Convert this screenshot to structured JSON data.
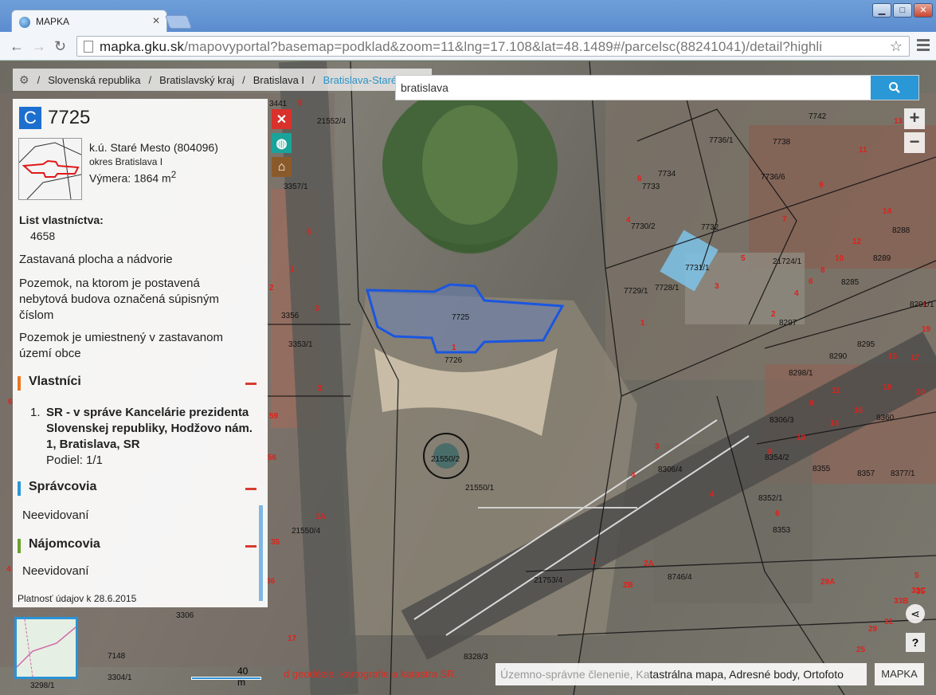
{
  "browser": {
    "tab_title": "MAPKA",
    "url_host": "mapka.gku.sk",
    "url_path": "/mapovyportal?basemap=podklad&zoom=11&lng=17.108&lat=48.1489#/parcelsc(88241041)/detail?highli",
    "win_min": "▁",
    "win_max": "□",
    "win_close": "✕"
  },
  "breadcrumb": {
    "items": [
      "Slovenská republika",
      "Bratislavský kraj",
      "Bratislava I",
      "Bratislava-Staré Mesto"
    ],
    "separator": "/"
  },
  "search": {
    "value": "bratislava"
  },
  "zoom": {
    "in": "+",
    "out": "−"
  },
  "panel": {
    "badge": "C",
    "parcel_number": "7725",
    "ku": "k.ú. Staré Mesto (804096)",
    "okres": "okres Bratislava I",
    "vymera_label": "Výmera: 1864 m",
    "vymera_sup": "2",
    "lv_label": "List vlastníctva:",
    "lv_value": "4658",
    "druh": "Zastavaná plocha a nádvorie",
    "pozemok1": "Pozemok, na ktorom je postavená nebytová budova označená súpisným číslom",
    "pozemok2": "Pozemok je umiestnený v zastavanom území obce",
    "vlastnici_title": "Vlastníci",
    "owner_index": "1.",
    "owner_name": "SR - v správe Kancelárie prezidenta Slovenskej republiky, Hodžovo nám. 1, Bratislava, SR",
    "owner_share": "Podiel: 1/1",
    "spravcovia_title": "Správcovia",
    "spravcovia_value": "Neevidovaní",
    "najomcovia_title": "Nájomcovia",
    "najomcovia_value": "Neevidovaní",
    "platnost": "Platnosť údajov k 28.6.2015"
  },
  "colors": {
    "accent": "#2a97d6",
    "vlastnici": "#e87722",
    "spravcovia": "#2a97d6",
    "najomcovia": "#6aa22c",
    "close": "#d9312b",
    "globe": "#1aa39a",
    "home": "#8b5a2b",
    "parcel_highlight": "#1a56e0"
  },
  "scale": {
    "label": "40 m"
  },
  "footer": {
    "attribution": "d geodézie, kartografie a katastra SR.",
    "layers_muted": "Územno-správne členenie, Ka",
    "layers_active": "tastrálna mapa, Adresné body, Ortofoto",
    "mapa_button": "MAPKA"
  },
  "map_labels": {
    "l1": "7725",
    "l2": "7726",
    "l3": "21550/2",
    "l4": "21550/1",
    "l5": "7732",
    "l6": "7734",
    "l7": "7736/1",
    "l8": "7738",
    "l9": "7742",
    "l10": "7731/1",
    "l11": "21724/1",
    "l12": "8289",
    "l13": "8297",
    "l14": "8306/3",
    "l15": "8306/4",
    "l16": "8357",
    "l17": "8353",
    "l18": "8746/4",
    "l19": "21753/4",
    "l20": "3356",
    "l21": "3441",
    "l22": "21552/4",
    "l23": "3357/1",
    "l24": "3353/1",
    "l25": "21550/4",
    "l26": "3306",
    "l27": "7148",
    "l28": "3298/1",
    "l29": "3304/1",
    "l30": "8328/3",
    "l31": "8360",
    "l32": "8298/1",
    "l33": "7730/2",
    "l34": "7728/1",
    "l35": "7729/1",
    "l36": "7733",
    "l37": "7736/6",
    "l38": "8288",
    "l39": "8295",
    "l40": "8290",
    "l41": "8377/1",
    "l42": "8352/1",
    "l43": "8354/2",
    "l44": "8355",
    "l45": "8291/1",
    "l46": "8285"
  }
}
